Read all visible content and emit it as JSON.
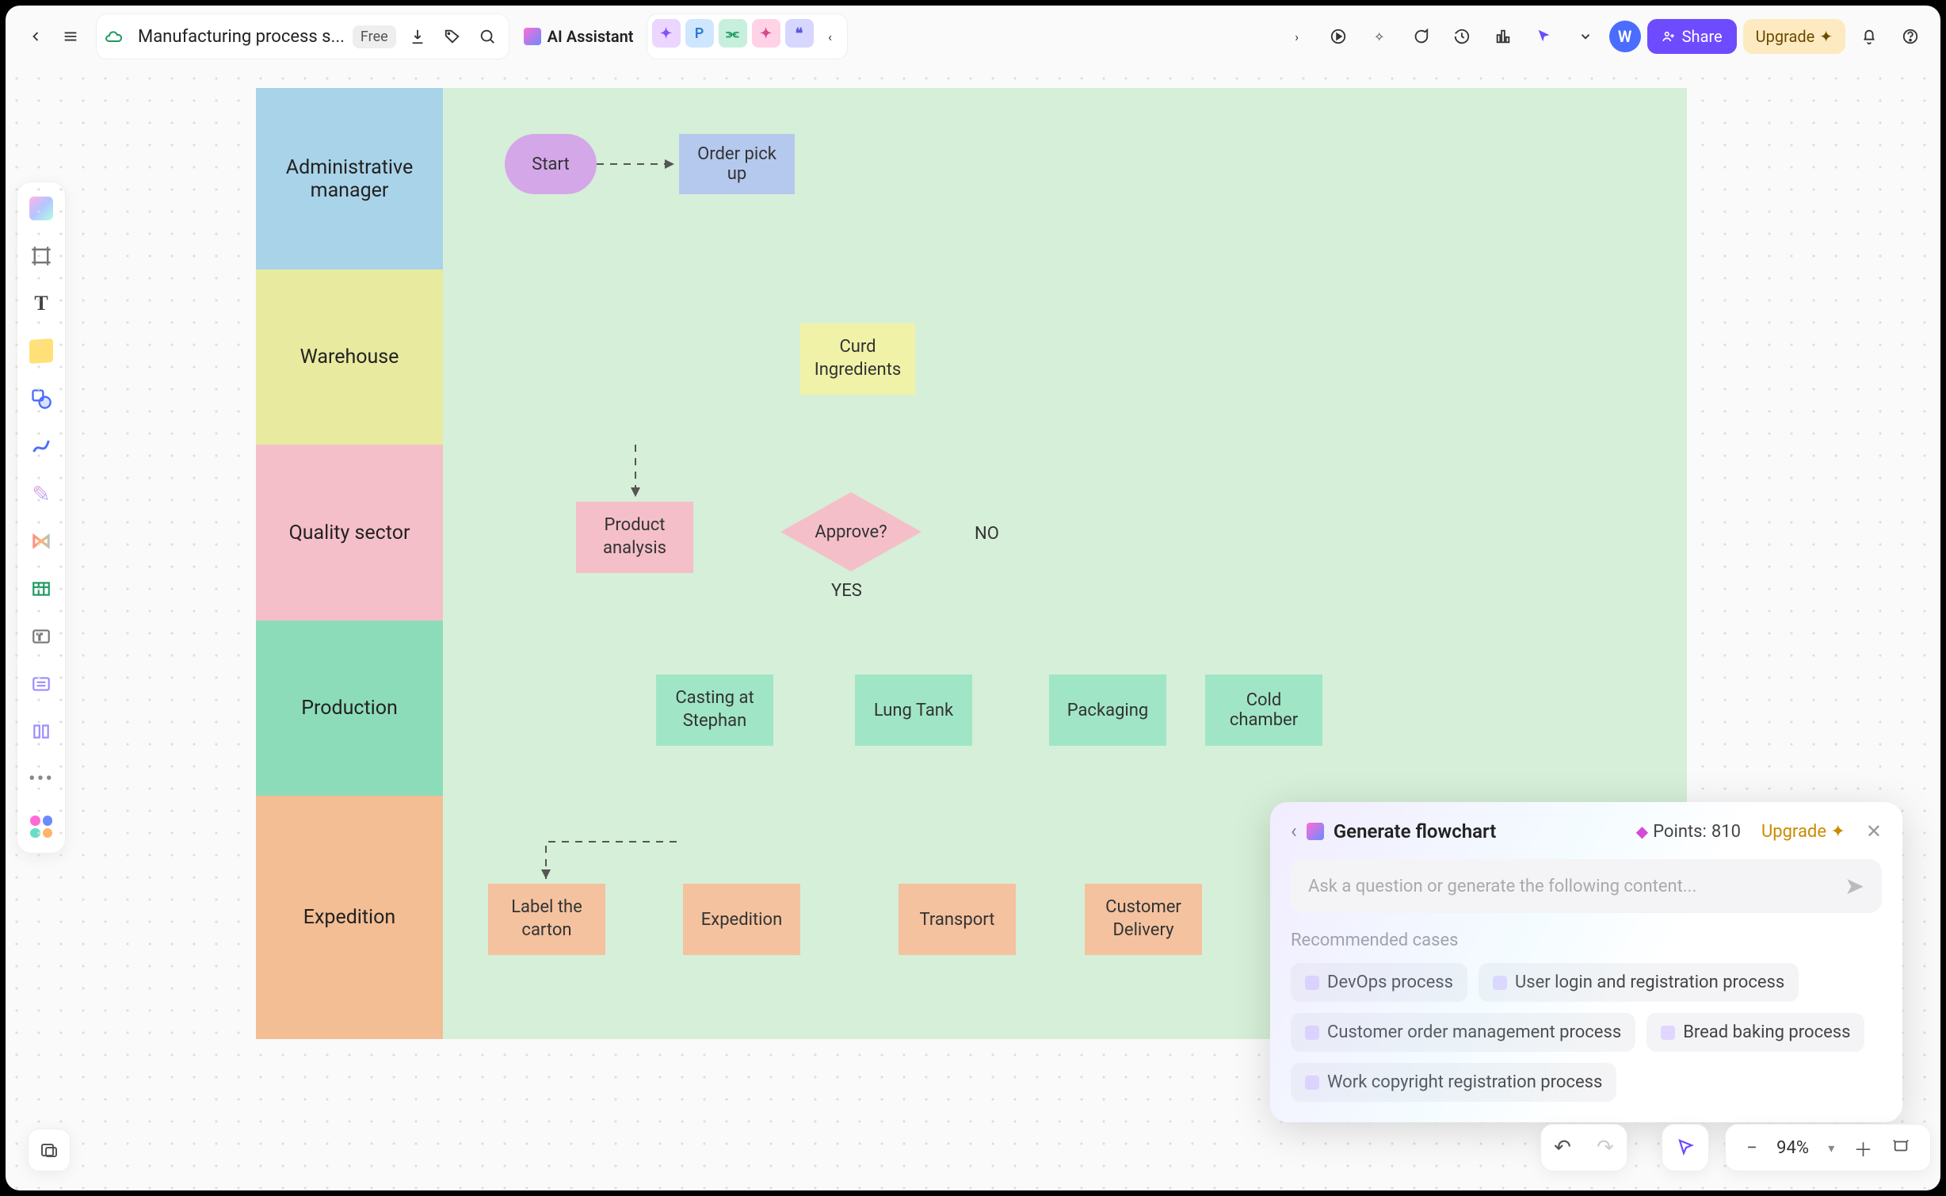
{
  "header": {
    "doc_title": "Manufacturing process s...",
    "free_badge": "Free",
    "ai_label": "AI Assistant",
    "avatar_letter": "W",
    "share": "Share",
    "upgrade": "Upgrade"
  },
  "lanes": {
    "l1": "Administrative manager",
    "l2": "Warehouse",
    "l3": "Quality sector",
    "l4": "Production",
    "l5": "Expedition"
  },
  "nodes": {
    "start": "Start",
    "order_pick": "Order pick up",
    "curd": "Curd Ingredients",
    "product_analysis": "Product analysis",
    "approve": "Approve?",
    "yes": "YES",
    "no": "NO",
    "casting": "Casting at Stephan",
    "lung": "Lung Tank",
    "packaging": "Packaging",
    "cold": "Cold chamber",
    "label_carton": "Label the carton",
    "expedition": "Expedition",
    "transport": "Transport",
    "delivery": "Customer Delivery"
  },
  "ai_panel": {
    "title": "Generate flowchart",
    "points_label": "Points:",
    "points_value": "810",
    "upgrade": "Upgrade",
    "placeholder": "Ask a question or generate the following content...",
    "rec_title": "Recommended cases",
    "chips": [
      "DevOps process",
      "User login and registration process",
      "Customer order management process",
      "Bread baking process",
      "Work copyright registration process"
    ]
  },
  "zoom": {
    "pct": "94%"
  }
}
